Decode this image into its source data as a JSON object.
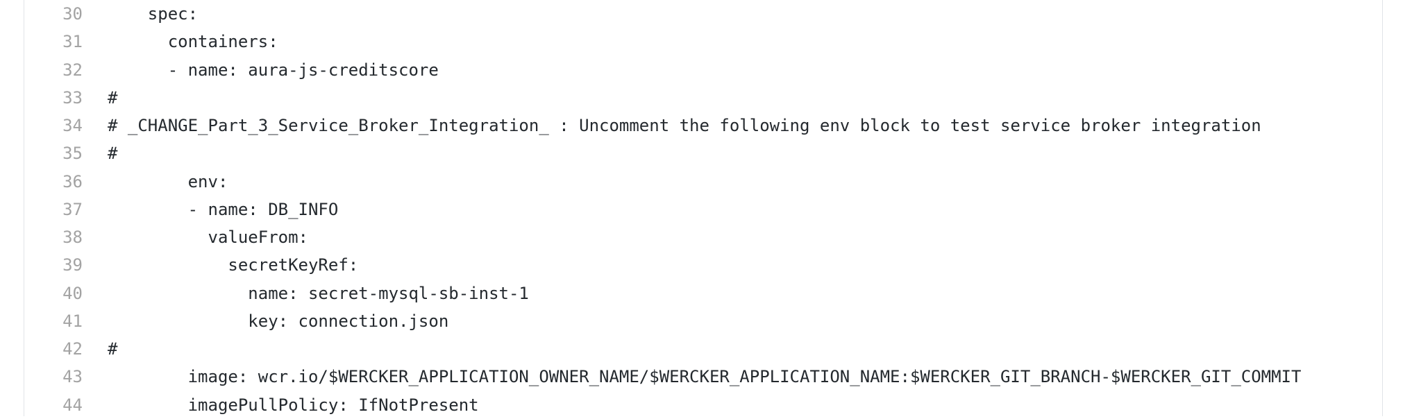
{
  "code": {
    "lines": [
      {
        "number": "30",
        "text": "    spec:"
      },
      {
        "number": "31",
        "text": "      containers:"
      },
      {
        "number": "32",
        "text": "      - name: aura-js-creditscore"
      },
      {
        "number": "33",
        "text": "#"
      },
      {
        "number": "34",
        "text": "# _CHANGE_Part_3_Service_Broker_Integration_ : Uncomment the following env block to test service broker integration"
      },
      {
        "number": "35",
        "text": "#"
      },
      {
        "number": "36",
        "text": "        env:"
      },
      {
        "number": "37",
        "text": "        - name: DB_INFO"
      },
      {
        "number": "38",
        "text": "          valueFrom:"
      },
      {
        "number": "39",
        "text": "            secretKeyRef:"
      },
      {
        "number": "40",
        "text": "              name: secret-mysql-sb-inst-1"
      },
      {
        "number": "41",
        "text": "              key: connection.json"
      },
      {
        "number": "42",
        "text": "#"
      },
      {
        "number": "43",
        "text": "        image: wcr.io/$WERCKER_APPLICATION_OWNER_NAME/$WERCKER_APPLICATION_NAME:$WERCKER_GIT_BRANCH-$WERCKER_GIT_COMMIT"
      },
      {
        "number": "44",
        "text": "        imagePullPolicy: IfNotPresent"
      }
    ]
  },
  "colors": {
    "line_number": "#a3a3a3",
    "code_text": "#24292e",
    "border": "#e1e4e8",
    "background": "#ffffff"
  }
}
